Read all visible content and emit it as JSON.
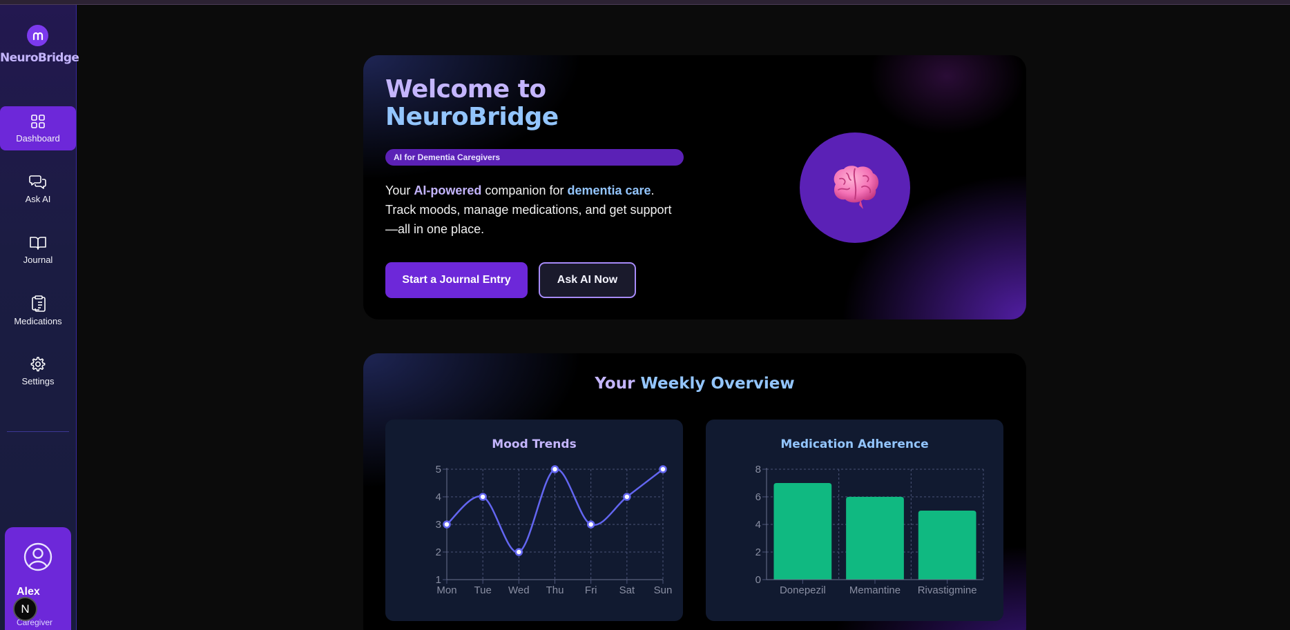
{
  "app": {
    "name": "NeuroBridge"
  },
  "sidebar": {
    "items": [
      {
        "label": "Dashboard",
        "icon": "grid-icon",
        "active": true
      },
      {
        "label": "Ask AI",
        "icon": "chat-icon",
        "active": false
      },
      {
        "label": "Journal",
        "icon": "book-icon",
        "active": false
      },
      {
        "label": "Medications",
        "icon": "clipboard-icon",
        "active": false
      },
      {
        "label": "Settings",
        "icon": "gear-icon",
        "active": false
      }
    ],
    "user": {
      "name": "Alex",
      "role": "Caregiver"
    },
    "dev_badge": "N"
  },
  "hero": {
    "title_line1": "Welcome to",
    "title_line2": "NeuroBridge",
    "badge": "AI for Dementia Caregivers",
    "desc_part1": "Your ",
    "desc_hl1": "AI-powered",
    "desc_part2": " companion for ",
    "desc_hl2": "dementia care",
    "desc_part3": ". Track moods, manage medications, and get support—all in one place.",
    "primary_button": "Start a Journal Entry",
    "secondary_button": "Ask AI Now",
    "illustration": "brain-icon"
  },
  "overview": {
    "title_part1": "Your ",
    "title_part2": "Weekly Overview"
  },
  "colors": {
    "accent": "#6d28d9",
    "lavender": "#c4b5fd",
    "sky": "#93c5fd",
    "line": "#6366f1",
    "bar": "#10b981"
  },
  "chart_data": [
    {
      "type": "line",
      "title": "Mood Trends",
      "categories": [
        "Mon",
        "Tue",
        "Wed",
        "Thu",
        "Fri",
        "Sat",
        "Sun"
      ],
      "values": [
        3,
        4,
        2,
        5,
        3,
        4,
        5
      ],
      "ylim": [
        1,
        5
      ],
      "yticks": [
        1,
        2,
        3,
        4,
        5
      ],
      "grid": true
    },
    {
      "type": "bar",
      "title": "Medication Adherence",
      "categories": [
        "Donepezil",
        "Memantine",
        "Rivastigmine"
      ],
      "values": [
        7,
        6,
        5
      ],
      "ylim": [
        0,
        8
      ],
      "yticks": [
        0,
        2,
        4,
        6,
        8
      ],
      "grid": true
    }
  ]
}
